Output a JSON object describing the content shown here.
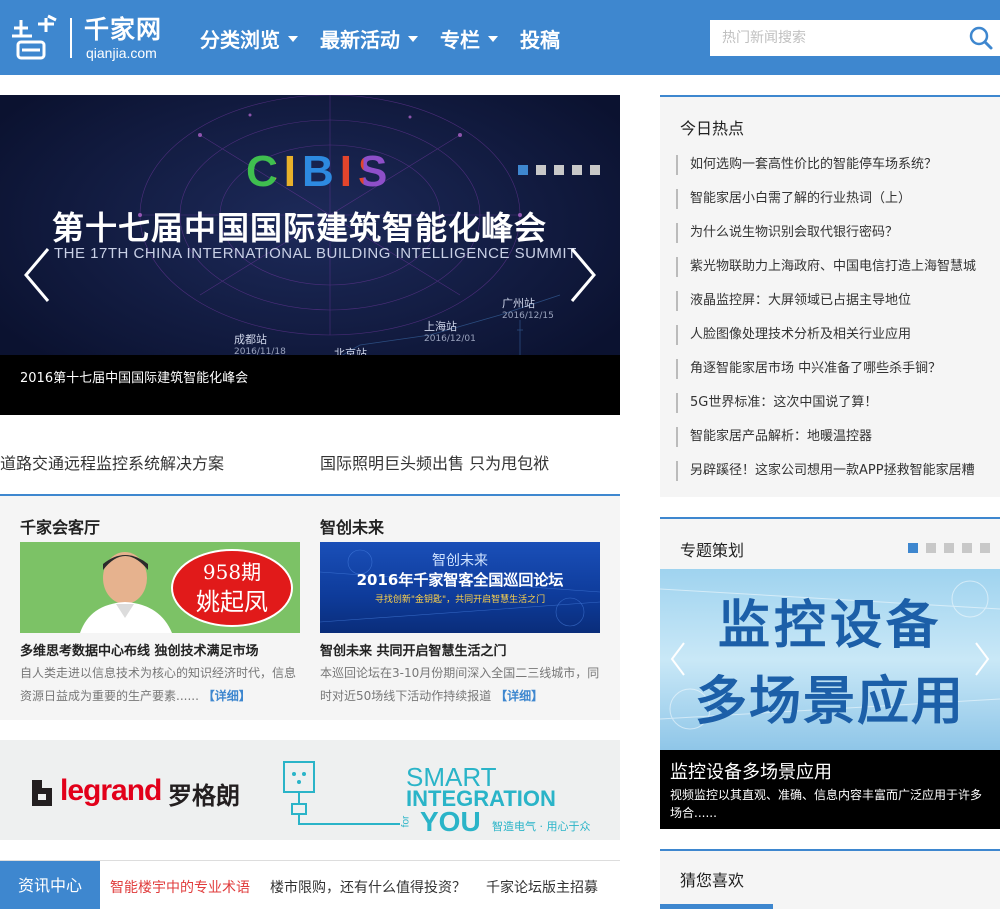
{
  "header": {
    "logo_cn": "千家网",
    "logo_en": "qianjia.com",
    "nav": [
      {
        "label": "分类浏览",
        "caret": true
      },
      {
        "label": "最新活动",
        "caret": true
      },
      {
        "label": "专栏",
        "caret": true
      },
      {
        "label": "投稿",
        "caret": false
      }
    ],
    "search_placeholder": "热门新闻搜索"
  },
  "slider": {
    "logo_text": "CIBIS",
    "headline": "第十七届中国国际建筑智能化峰会",
    "subline": "THE 17TH CHINA INTERNATIONAL BUILDING INTELLIGENCE SUMMIT",
    "stations": [
      {
        "name": "广州站",
        "date": "2016/12/15"
      },
      {
        "name": "上海站",
        "date": "2016/12/01"
      },
      {
        "name": "成都站",
        "date": "2016/11/18"
      },
      {
        "name": "北京站",
        "date": ""
      }
    ],
    "caption": "2016第十七届中国国际建筑智能化峰会",
    "dots": 5,
    "active_dot": 0
  },
  "links_row": [
    "道路交通远程监控系统解决方案",
    "国际照明巨头频出售 只为甩包袱"
  ],
  "columns": [
    {
      "title": "千家会客厅",
      "img_issue": "958期",
      "img_name": "姚起凤",
      "head": "多维思考数据中心布线 独创技术满足市场",
      "body": "自人类走进以信息技术为核心的知识经济时代，信息资源日益成为重要的生产要素......",
      "more": "【详细】"
    },
    {
      "title": "智创未来",
      "img_title": "智创未来",
      "img_main": "2016年千家智客全国巡回论坛",
      "img_sub": "寻找创新\"金钥匙\"，共同开启智慧生活之门",
      "head": "智创未来 共同开启智慧生活之门",
      "body": "本巡回论坛在3-10月份期间深入全国二三线城市，同时对近50场线下活动作持续报道",
      "more": "【详细】"
    }
  ],
  "ad": {
    "brand_en": "legrand",
    "brand_cn": "罗格朗",
    "smart": "SMART",
    "integration": "INTEGRATION",
    "for": "for",
    "you": "YOU",
    "slogan": "智造电气 · 用心于众"
  },
  "news_center": {
    "tab": "资讯中心",
    "links": [
      {
        "text": "智能楼宇中的专业术语",
        "highlight": true
      },
      {
        "text": "楼市限购，还有什么值得投资？",
        "highlight": false
      },
      {
        "text": "千家论坛版主招募",
        "highlight": false
      }
    ]
  },
  "hot": {
    "title": "今日热点",
    "items": [
      "如何选购一套高性价比的智能停车场系统？",
      "智能家居小白需了解的行业热词（上）",
      "为什么说生物识别会取代银行密码？",
      "紫光物联助力上海政府、中国电信打造上海智慧城",
      "液晶监控屏：大屏领域已占据主导地位",
      "人脸图像处理技术分析及相关行业应用",
      "角逐智能家居市场 中兴准备了哪些杀手锏？",
      "5G世界标准：这次中国说了算！",
      "智能家居产品解析：地暖温控器",
      "另辟蹊径！这家公司想用一款APP拯救智能家居糟"
    ]
  },
  "special": {
    "title": "专题策划",
    "img_line1": "监控设备",
    "img_line2": "多场景应用",
    "caption_title": "监控设备多场景应用",
    "caption_desc": "视频监控以其直观、准确、信息内容丰富而广泛应用于许多场合......",
    "dots": 5,
    "active_dot": 0
  },
  "guess": {
    "title": "猜您喜欢"
  },
  "colors": {
    "brand_blue": "#3e87cf",
    "highlight_red": "#e03c3c"
  }
}
